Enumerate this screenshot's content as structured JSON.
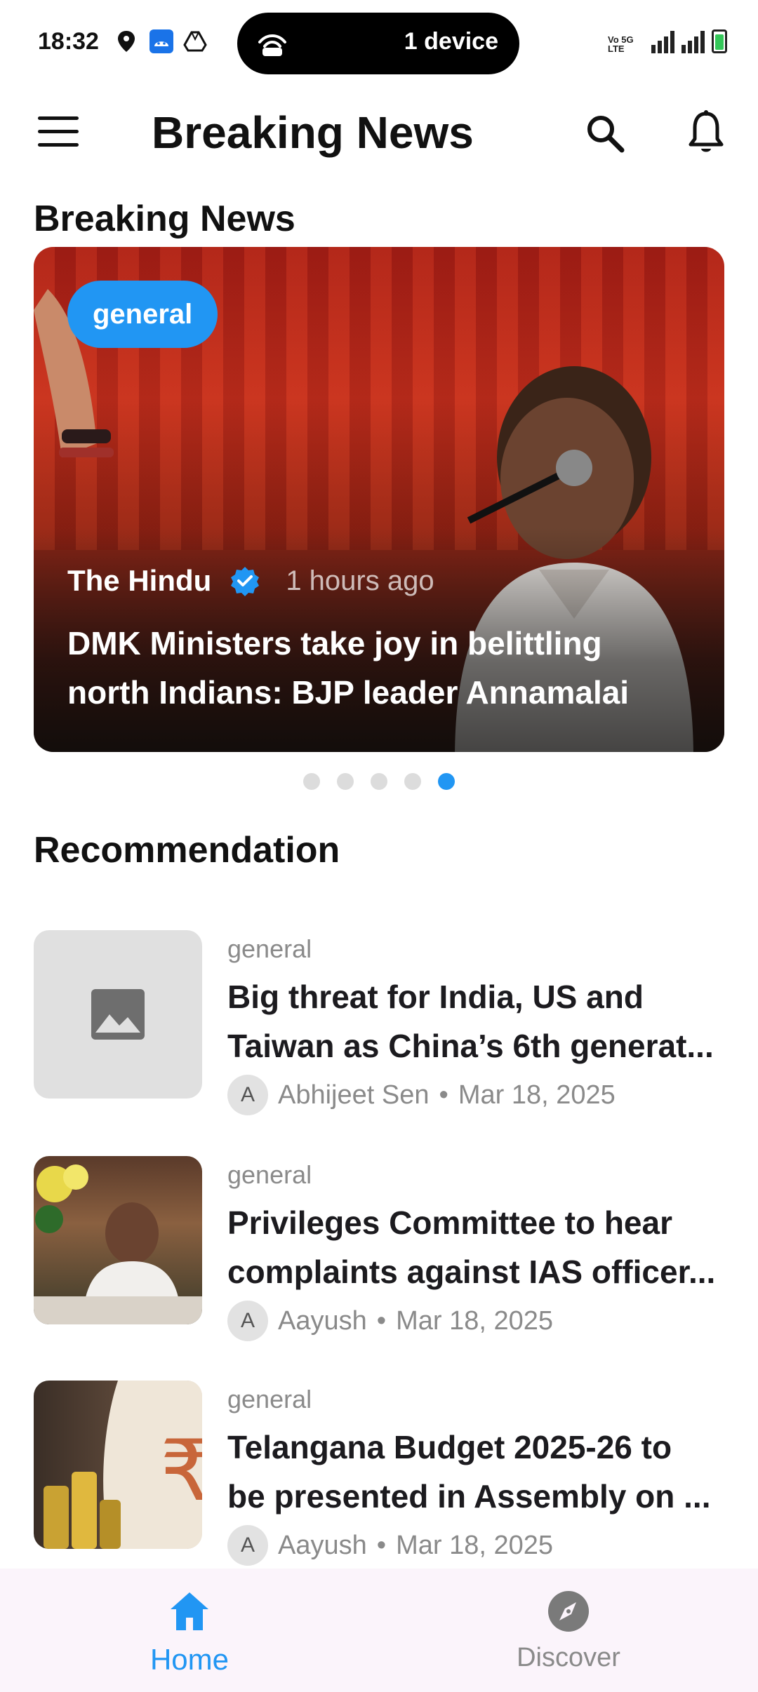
{
  "status_bar": {
    "time": "18:32",
    "pill_text": "1 device",
    "network": "Vo 5G LTE",
    "icons": [
      "location-icon",
      "android-icon",
      "drive-icon",
      "hotspot-icon",
      "signal-icon",
      "battery-icon"
    ]
  },
  "app_bar": {
    "title": "Breaking News",
    "icons": [
      "menu-icon",
      "search-icon",
      "bell-icon"
    ]
  },
  "sections": {
    "breaking": "Breaking News",
    "recommendation": "Recommendation"
  },
  "hero": {
    "category": "general",
    "source": "The Hindu",
    "time": "1 hours ago",
    "headline_line1": "DMK Ministers take joy in belittling",
    "headline_line2": "north Indians: BJP leader Annamalai"
  },
  "carousel": {
    "total": 5,
    "active_index": 4
  },
  "recommendations": [
    {
      "category": "general",
      "title_line1": "Big threat for India, US and",
      "title_line2": "Taiwan as China’s 6th generat...",
      "avatar": "A",
      "author": "Abhijeet Sen",
      "date": "Mar 18, 2025",
      "thumb": "placeholder"
    },
    {
      "category": "general",
      "title_line1": "Privileges Committee to hear",
      "title_line2": "complaints against IAS officer...",
      "avatar": "A",
      "author": "Aayush",
      "date": "Mar 18, 2025",
      "thumb": "photo"
    },
    {
      "category": "general",
      "title_line1": "Telangana Budget 2025-26 to",
      "title_line2": "be presented in Assembly on ...",
      "avatar": "A",
      "author": "Aayush",
      "date": "Mar 18, 2025",
      "thumb": "photo"
    }
  ],
  "bottom_nav": {
    "home": "Home",
    "discover": "Discover",
    "active": "home"
  },
  "colors": {
    "accent": "#2196f3",
    "nav_background": "#fbf4fb",
    "muted_text": "#8a8a8a"
  }
}
